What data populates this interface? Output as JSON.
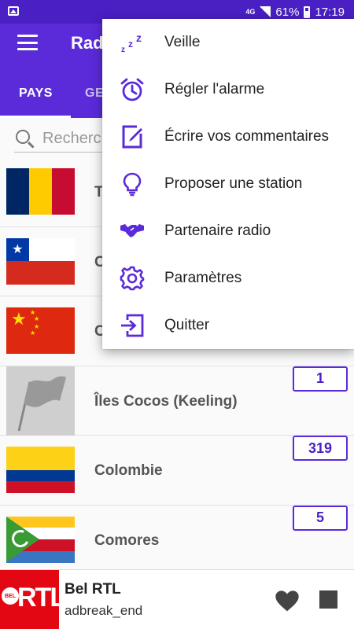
{
  "status_bar": {
    "network": "4G",
    "battery": "61%",
    "time": "17:19"
  },
  "app_bar": {
    "title": "Rad",
    "tabs": [
      {
        "label": "PAYS",
        "active": true
      },
      {
        "label": "GE",
        "active": false
      }
    ]
  },
  "search": {
    "placeholder": "Recherc"
  },
  "countries": [
    {
      "name": "T",
      "flag": "chad",
      "count": ""
    },
    {
      "name": "C",
      "flag": "chile",
      "count": ""
    },
    {
      "name": "C",
      "flag": "china",
      "count": ""
    },
    {
      "name": "Îles Cocos (Keeling)",
      "flag": "generic-flag",
      "count": "1"
    },
    {
      "name": "Colombie",
      "flag": "colombia",
      "count": "319"
    },
    {
      "name": "Comores",
      "flag": "comoros",
      "count": "5"
    }
  ],
  "menu": {
    "items": [
      {
        "label": "Veille",
        "icon": "sleep-icon"
      },
      {
        "label": "Régler l'alarme",
        "icon": "alarm-clock-icon"
      },
      {
        "label": "Écrire vos commentaires",
        "icon": "edit-icon"
      },
      {
        "label": "Proposer une station",
        "icon": "lightbulb-icon"
      },
      {
        "label": "Partenaire radio",
        "icon": "handshake-icon"
      },
      {
        "label": "Paramètres",
        "icon": "gear-icon"
      },
      {
        "label": "Quitter",
        "icon": "exit-icon"
      }
    ]
  },
  "player": {
    "logo_text": "RTL",
    "logo_badge": "BEL",
    "station": "Bel RTL",
    "status": "adbreak_end"
  },
  "colors": {
    "primary": "#5b2bd9",
    "status_bar": "#4a1fc4",
    "accent_icon": "#5b2bd9"
  }
}
